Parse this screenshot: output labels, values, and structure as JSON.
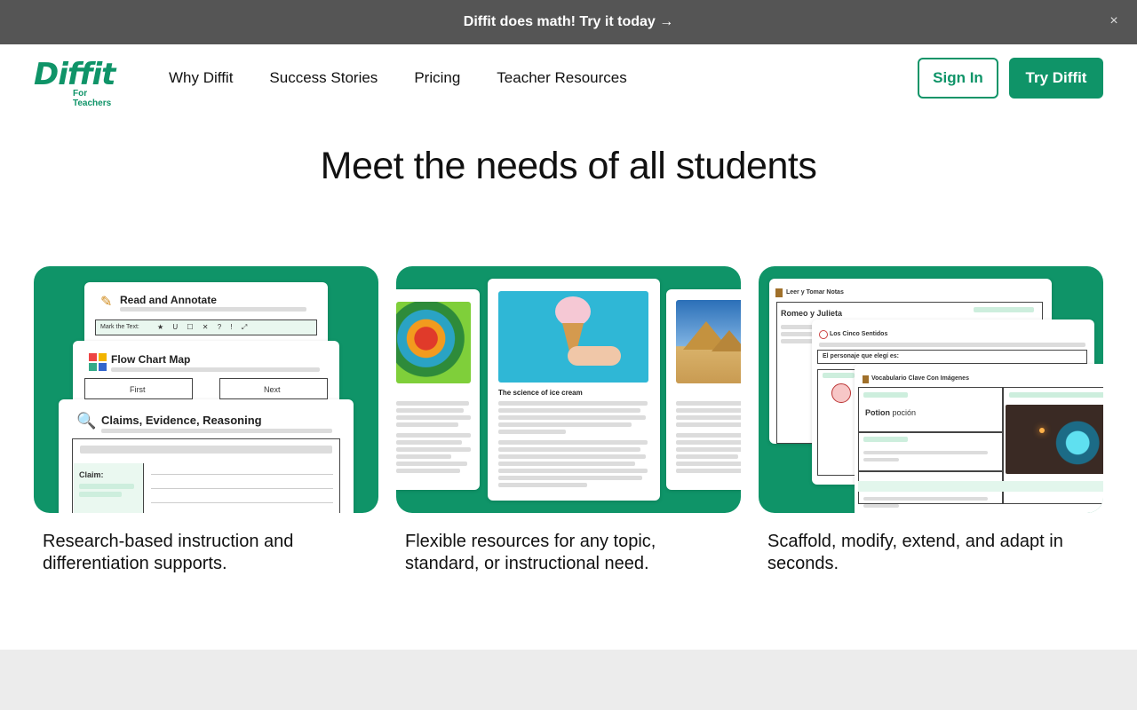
{
  "announcement": {
    "text": "Diffit does math! Try it today →",
    "close": "×"
  },
  "logo": {
    "word": "Diffit",
    "sub": "For Teachers"
  },
  "nav": [
    {
      "label": "Why Diffit"
    },
    {
      "label": "Success Stories"
    },
    {
      "label": "Pricing"
    },
    {
      "label": "Teacher Resources"
    }
  ],
  "header": {
    "signin_label": "Sign In",
    "try_label": "Try Diffit"
  },
  "hero": {
    "title": "Meet the needs of all students"
  },
  "cards": [
    {
      "caption": "Research-based instruction and differentiation supports.",
      "sheets": {
        "read": "Read and Annotate",
        "mark": "Mark the Text:",
        "mark_symbols": "★  U  ☐  ✕  ?  !  ⤢",
        "flow": "Flow Chart Map",
        "first": "First",
        "next": "Next",
        "claims": "Claims, Evidence, Reasoning",
        "claim": "Claim:"
      }
    },
    {
      "caption": "Flexible resources for any topic, standard, or instructional need.",
      "sheets": {
        "icecream_title": "The science of ice cream"
      }
    },
    {
      "caption": "Scaffold, modify, extend, and adapt in seconds.",
      "sheets": {
        "notes": "Leer y Tomar Notas",
        "romeo": "Romeo y Julieta",
        "senses": "Los Cinco Sentidos",
        "chosen": "El personaje que elegí es:",
        "vocab": "Vocabulario Clave Con Imágenes",
        "potion_en": "Potion",
        "potion_es": "poción"
      }
    }
  ],
  "colors": {
    "brand": "#0f9468",
    "announce_bg": "#555555",
    "footer_bg": "#ececec"
  }
}
